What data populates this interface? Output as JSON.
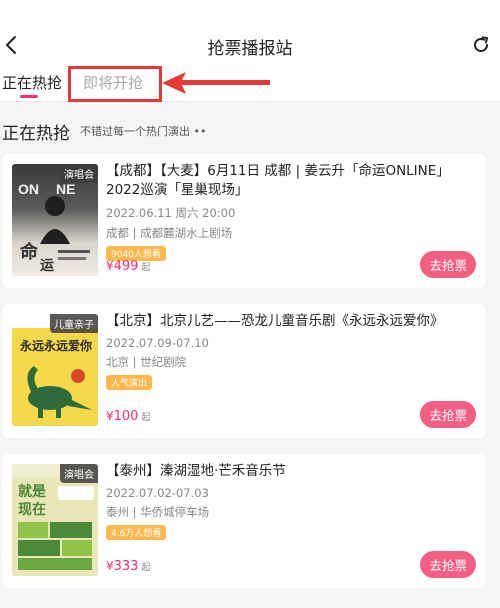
{
  "header": {
    "title": "抢票播报站"
  },
  "tabs": [
    {
      "label": "正在热抢"
    },
    {
      "label": "即将开抢"
    }
  ],
  "section": {
    "title": "正在热抢",
    "subtitle": "不错过每一个热门演出 ••"
  },
  "events": [
    {
      "tag": "演唱会",
      "name": "【成都】【大麦】6月11日 成都 | 姜云升「命运ONLINE」2022巡演「星巢现场」",
      "date": "2022.06.11 周六 20:00",
      "venue": "成都 | 成都麓湖水上剧场",
      "badge": "9040人想看",
      "price_symbol": "¥",
      "price": "499",
      "price_unit": "起",
      "button": "去抢票"
    },
    {
      "tag": "儿童亲子",
      "name": "【北京】北京儿艺——恐龙儿童音乐剧《永远永远爱你》",
      "date": "2022.07.09-07.10",
      "venue": "北京 | 世纪剧院",
      "badge": "人气演出",
      "price_symbol": "¥",
      "price": "100",
      "price_unit": "起",
      "button": "去抢票"
    },
    {
      "tag": "演唱会",
      "name": "【泰州】溱湖湿地·芒禾音乐节",
      "date": "2022.07.02-07.03",
      "venue": "泰州 | 华侨城停车场",
      "badge": "4.6万人想看",
      "price_symbol": "¥",
      "price": "333",
      "price_unit": "起",
      "button": "去抢票"
    }
  ],
  "colors": {
    "accent": "#ff2e6d",
    "button": "#f35f83",
    "annotation": "#e53935",
    "badge": "#ffb84d"
  }
}
